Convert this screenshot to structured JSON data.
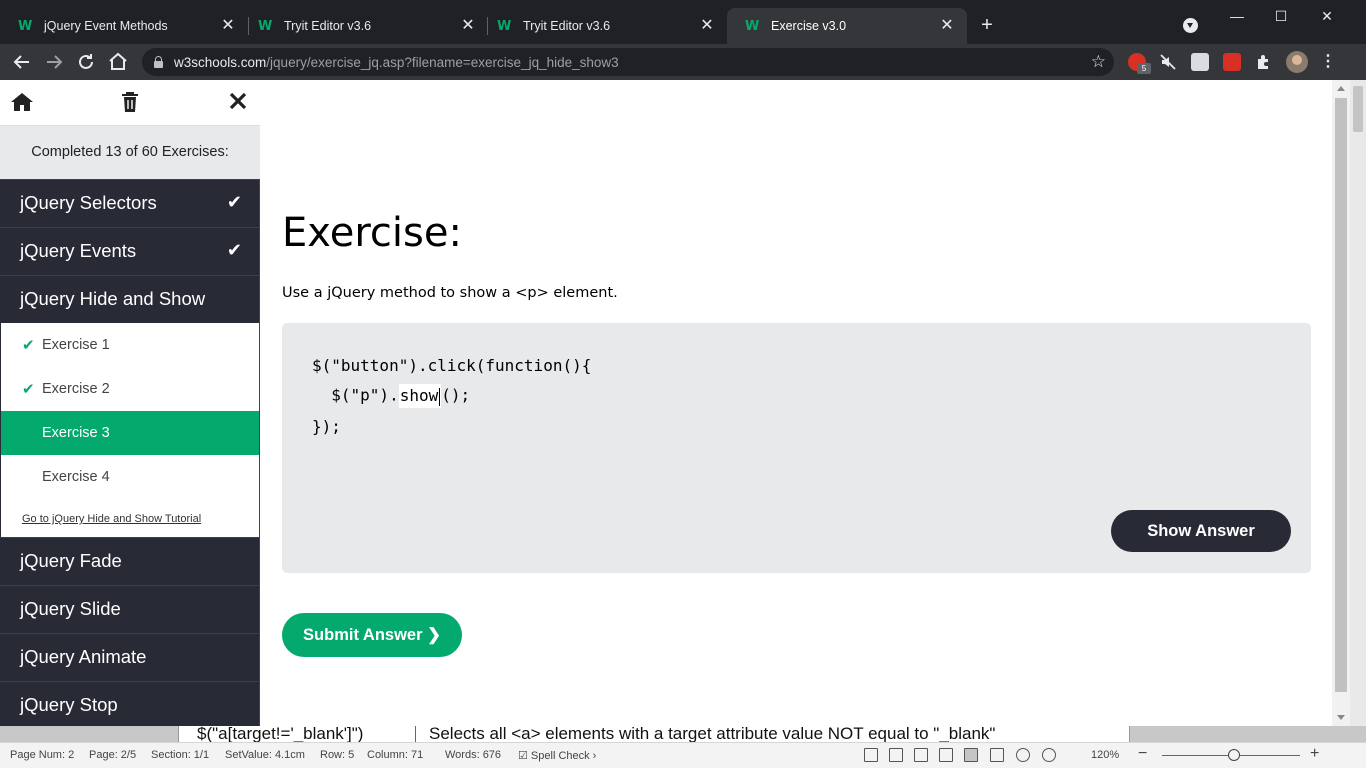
{
  "browser": {
    "tabs": [
      {
        "title": "jQuery Event Methods",
        "active": false
      },
      {
        "title": "Tryit Editor v3.6",
        "active": false
      },
      {
        "title": "Tryit Editor v3.6",
        "active": false
      },
      {
        "title": "Exercise v3.0",
        "active": true
      }
    ],
    "favicon_glyph": "W",
    "tab_close_glyph": "✕",
    "new_tab_glyph": "+",
    "window_controls": {
      "minimize": "—",
      "maximize": "☐",
      "close": "✕"
    },
    "url": {
      "host": "w3schools.com",
      "path": "/jquery/exercise_jq.asp?filename=exercise_jq_hide_show3"
    },
    "extension_badge": "5",
    "accent_color": "#04aa6d"
  },
  "sidebar": {
    "progress_text": "Completed 13 of 60 Exercises:",
    "categories": [
      {
        "label": "jQuery Selectors",
        "completed": true
      },
      {
        "label": "jQuery Events",
        "completed": true
      },
      {
        "label": "jQuery Hide and Show",
        "completed": false,
        "expanded": true
      },
      {
        "label": "jQuery Fade",
        "completed": false
      },
      {
        "label": "jQuery Slide",
        "completed": false
      },
      {
        "label": "jQuery Animate",
        "completed": false
      },
      {
        "label": "jQuery Stop",
        "completed": false
      }
    ],
    "exercises": [
      {
        "label": "Exercise 1",
        "done": true
      },
      {
        "label": "Exercise 2",
        "done": true
      },
      {
        "label": "Exercise 3",
        "done": false,
        "current": true
      },
      {
        "label": "Exercise 4",
        "done": false
      }
    ],
    "tutorial_link": "Go to jQuery Hide and Show Tutorial",
    "check_glyph": "✔",
    "colors": {
      "dark": "#282a35",
      "highlight": "#04aa6d"
    }
  },
  "main": {
    "title": "Exercise:",
    "description": "Use a jQuery method to show a <p> element.",
    "code": {
      "line1": "$(\"button\").click(function(){",
      "line2_before": "  $(\"p\").",
      "input_value": "show",
      "line2_after": "();",
      "line3": "});"
    },
    "show_answer_label": "Show Answer",
    "submit_label": "Submit Answer ❯"
  },
  "behind_window": {
    "cell_left": "$(\"a[target!='_blank']\")",
    "cell_right": "Selects all <a> elements with a target attribute value NOT equal to \"_blank\""
  },
  "statusbar": {
    "page_num": "Page Num: 2",
    "page": "Page: 2/5",
    "section": "Section: 1/1",
    "set_value": "SetValue: 4.1cm",
    "row": "Row: 5",
    "column": "Column: 71",
    "words": "Words: 676",
    "spell_check": "Spell Check",
    "zoom": "120%"
  }
}
